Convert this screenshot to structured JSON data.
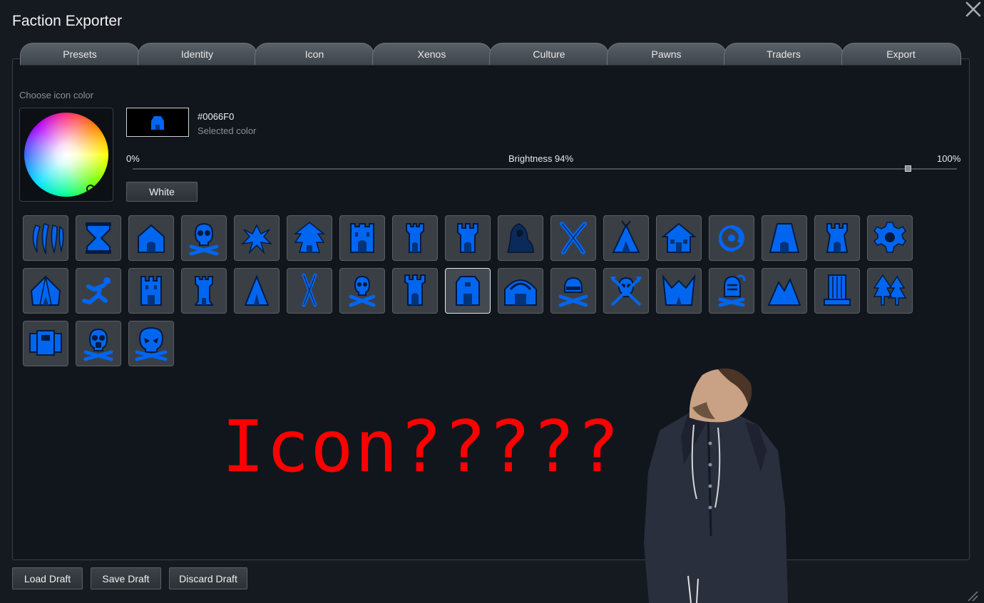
{
  "window": {
    "title": "Faction Exporter"
  },
  "tabs": [
    "Presets",
    "Identity",
    "Icon",
    "Xenos",
    "Culture",
    "Pawns",
    "Traders",
    "Export"
  ],
  "icon_tab": {
    "color_label": "Choose icon color",
    "hex": "#0066F0",
    "selected_color_label": "Selected color",
    "accent_color": "#0066F0",
    "brightness": {
      "min_label": "0%",
      "label": "Brightness 94%",
      "max_label": "100%",
      "value": 0.94
    },
    "white_button": "White",
    "icons_row1": [
      "claws-icon",
      "hourglass-icon",
      "hut-icon",
      "skull-bones-icon",
      "insect-icon",
      "pagoda-icon",
      "castle-icon",
      "tower-icon",
      "rook-icon",
      "hooded-figure-icon",
      "crossed-tusks-icon",
      "teepee-icon",
      "house-icon",
      "spiral-icon",
      "mountain-gate-icon",
      "keep-icon",
      "gear-icon"
    ],
    "icons_row2": [
      "tent-icon",
      "running-man-icon",
      "fortress-icon",
      "watchtower-icon",
      "a-frame-tent-icon",
      "crossed-spears-icon",
      "skull-crossbones-icon",
      "battlement-icon",
      "temple-icon",
      "barn-icon",
      "helmet-wrenches-icon",
      "skull-axes-icon",
      "horned-camp-icon",
      "knight-helm-icon",
      "twin-peaks-icon",
      "pillar-icon",
      "pine-trees-icon"
    ],
    "icons_row3": [
      "mech-icon",
      "gasmask-skull-icon",
      "alien-skull-icon"
    ],
    "selected_icon": "temple-icon"
  },
  "overlay": {
    "caption": "Icon?????"
  },
  "footer": {
    "load": "Load Draft",
    "save": "Save Draft",
    "discard": "Discard Draft"
  }
}
